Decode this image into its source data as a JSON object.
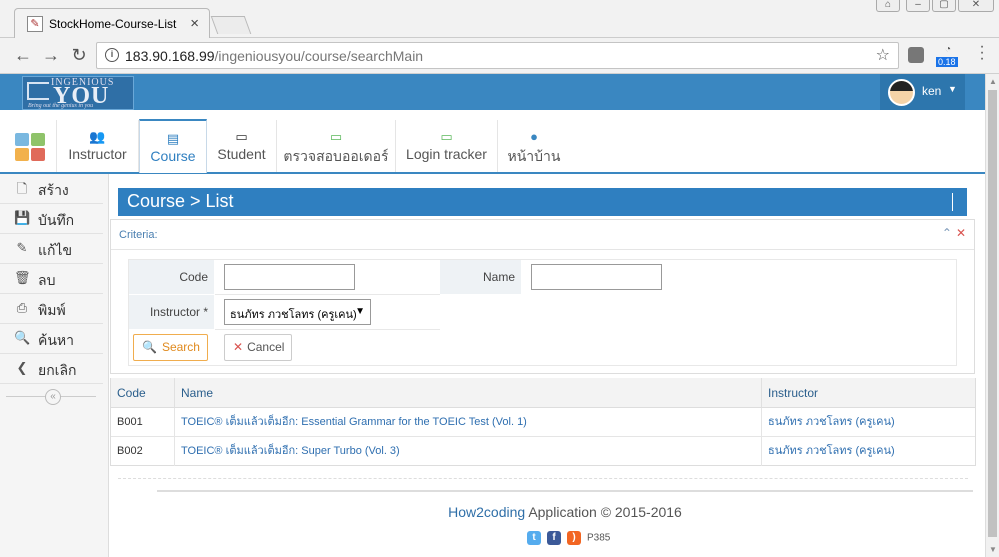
{
  "browser": {
    "tab_title": "StockHome-Course-List",
    "url_host": "183.90.168.99",
    "url_path": "/ingeniousyou/course/searchMain",
    "ext_badge": "0.18"
  },
  "header": {
    "logo_top": "INGENIOUS",
    "logo_main": "YOU",
    "logo_tagline": "Bring out the genius in you",
    "user_name": "ken"
  },
  "nav": {
    "items": [
      {
        "label": "Instructor",
        "icon": "users-icon"
      },
      {
        "label": "Course",
        "icon": "book-icon"
      },
      {
        "label": "Student",
        "icon": "monitor-icon"
      },
      {
        "label": "ตรวจสอบออเดอร์",
        "icon": "laptop-icon"
      },
      {
        "label": "Login tracker",
        "icon": "laptop-icon"
      },
      {
        "label": "หน้าบ้าน",
        "icon": "globe-icon"
      }
    ],
    "active": "Course"
  },
  "sidebar": {
    "items": [
      {
        "label": "สร้าง",
        "icon": "file-icon"
      },
      {
        "label": "บันทึก",
        "icon": "save-icon"
      },
      {
        "label": "แก้ไข",
        "icon": "edit-icon"
      },
      {
        "label": "ลบ",
        "icon": "trash-icon"
      },
      {
        "label": "พิมพ์",
        "icon": "print-icon"
      },
      {
        "label": "ค้นหา",
        "icon": "search-icon"
      },
      {
        "label": "ยกเลิก",
        "icon": "chevron-left-icon"
      }
    ]
  },
  "page": {
    "title": "Course > List",
    "criteria_title": "Criteria:",
    "code_label": "Code",
    "code_value": "",
    "name_label": "Name",
    "name_value": "",
    "instructor_label": "Instructor *",
    "instructor_value": "ธนภัทร ภวชโลทร (ครูเคน)",
    "search_label": "Search",
    "cancel_label": "Cancel"
  },
  "table": {
    "headers": [
      "Code",
      "Name",
      "Instructor"
    ],
    "rows": [
      {
        "code": "B001",
        "name": "TOEIC® เต็มแล้วเต็มอีก: Essential Grammar for the TOEIC Test (Vol. 1)",
        "instructor": "ธนภัทร ภวชโลทร (ครูเคน)"
      },
      {
        "code": "B002",
        "name": "TOEIC® เต็มแล้วเต็มอีก: Super Turbo (Vol. 3)",
        "instructor": "ธนภัทร ภวชโลทร (ครูเคน)"
      }
    ]
  },
  "footer": {
    "brand": "How2coding",
    "text": "Application © 2015-2016",
    "code": "P385"
  },
  "colors": {
    "primary": "#3a87c1",
    "header_bar": "#2f7fc0",
    "search_button": "#f0ad4e",
    "cancel_icon": "#d9534f"
  }
}
